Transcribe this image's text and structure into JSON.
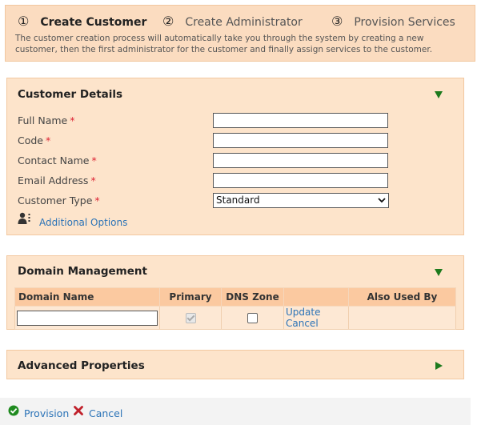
{
  "steps": [
    {
      "num": "①",
      "label": "Create Customer",
      "active": true
    },
    {
      "num": "②",
      "label": "Create Administrator",
      "active": false
    },
    {
      "num": "③",
      "label": "Provision Services",
      "active": false
    }
  ],
  "steps_description": "The customer creation process will automatically take you through the system by creating a new customer, then the first administrator for the customer and finally assign services to the customer.",
  "customer_details": {
    "title": "Customer Details",
    "fields": [
      {
        "label": "Full Name",
        "required": "*",
        "value": ""
      },
      {
        "label": "Code",
        "required": "*",
        "value": ""
      },
      {
        "label": "Contact Name",
        "required": "*",
        "value": ""
      },
      {
        "label": "Email Address",
        "required": "*",
        "value": ""
      }
    ],
    "customer_type": {
      "label": "Customer Type",
      "required": "*",
      "selected": "Standard"
    },
    "additional_options": "Additional Options"
  },
  "domain_management": {
    "title": "Domain Management",
    "columns": [
      "Domain Name",
      "Primary",
      "DNS Zone",
      "",
      "Also Used By"
    ],
    "row": {
      "domain_name": "",
      "primary_checked": true,
      "dns_zone_checked": false,
      "update": "Update",
      "cancel": "Cancel",
      "also_used_by": ""
    }
  },
  "advanced_properties": {
    "title": "Advanced Properties"
  },
  "footer": {
    "provision": "Provision",
    "cancel": "Cancel"
  },
  "colors": {
    "accent_link": "#2b73b7",
    "panel_bg": "#fde4cb",
    "header_bg": "#fbc9a0",
    "toggle_green": "#1d7a1d",
    "required_red": "#d23"
  }
}
